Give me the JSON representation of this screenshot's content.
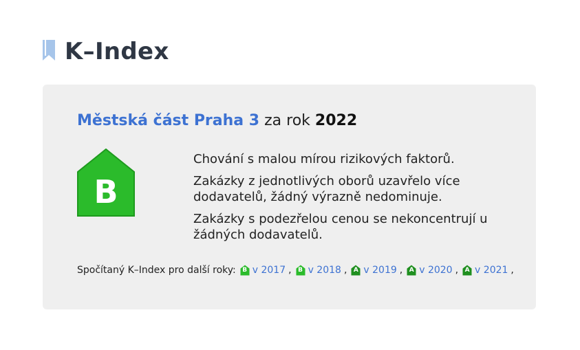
{
  "header": {
    "title": "K–Index",
    "icon": "bookmark-icon",
    "icon_color": "#a6c5ea"
  },
  "card": {
    "entity": "Městská část Praha 3",
    "year_prefix": "za rok",
    "year": "2022",
    "rating": "B",
    "rating_color": "#2bbb2b",
    "descriptions": [
      "Chování s malou mírou rizikových faktorů.",
      "Zakázky z jednotlivých oborů uzavřelo více dodavatelů, žádný výrazně nedominuje.",
      "Zakázky s podezřelou cenou se nekoncentrují u žádných dodavatelů."
    ],
    "other_years_label": "Spočítaný K–Index pro další roky:",
    "other_years": [
      {
        "rating": "B",
        "label": "v 2017",
        "color": "#2bbb2b"
      },
      {
        "rating": "B",
        "label": "v 2018",
        "color": "#2bbb2b"
      },
      {
        "rating": "A",
        "label": "v 2019",
        "color": "#1f8f1f"
      },
      {
        "rating": "A",
        "label": "v 2020",
        "color": "#1f8f1f"
      },
      {
        "rating": "A",
        "label": "v 2021",
        "color": "#1f8f1f"
      }
    ],
    "separator": ","
  },
  "colors": {
    "link": "#3d72d2",
    "card_background": "#efefef",
    "title": "#2f3744"
  }
}
